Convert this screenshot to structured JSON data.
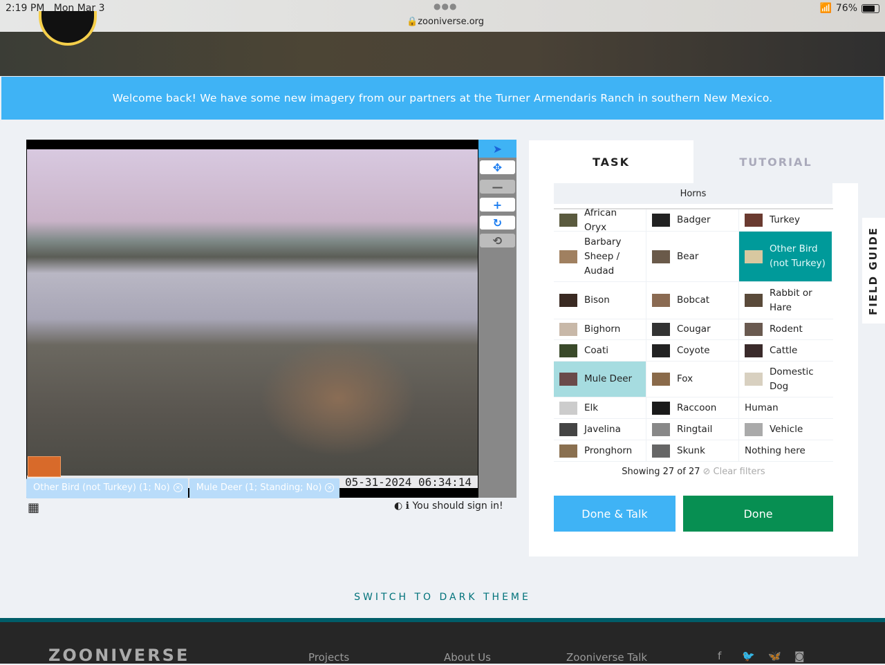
{
  "status_bar": {
    "time": "2:19 PM",
    "date": "Mon Mar 3",
    "url": "zooniverse.org",
    "battery": "76%"
  },
  "banner": "Welcome back! We have some new imagery from our partners at the Turner Armendaris Ranch in southern New Mexico.",
  "viewer": {
    "timestamp": "05-31-2024  06:34:14",
    "tools": [
      "pointer-icon",
      "move-icon",
      "zoom-out-icon",
      "zoom-in-icon",
      "rotate-icon",
      "reset-icon"
    ],
    "annotations": [
      {
        "label": "Other Bird (not Turkey) (1; No)"
      },
      {
        "label": "Mule Deer (1; Standing; No)"
      }
    ],
    "sign_in": "You should sign in!"
  },
  "tabs": [
    {
      "label": "TASK",
      "active": true
    },
    {
      "label": "TUTORIAL",
      "active": false
    }
  ],
  "filter": "Horns",
  "choices": [
    [
      "African Oryx",
      "Badger",
      "Turkey"
    ],
    [
      "Barbary Sheep / Audad",
      "Bear",
      "Other Bird (not Turkey)"
    ],
    [
      "Bison",
      "Bobcat",
      "Rabbit or Hare"
    ],
    [
      "Bighorn",
      "Cougar",
      "Rodent"
    ],
    [
      "Coati",
      "Coyote",
      "Cattle"
    ],
    [
      "Mule Deer",
      "Fox",
      "Domestic Dog"
    ],
    [
      "Elk",
      "Raccoon",
      "Human"
    ],
    [
      "Javelina",
      "Ringtail",
      "Vehicle"
    ],
    [
      "Pronghorn",
      "Skunk",
      "Nothing here"
    ]
  ],
  "selected": [
    "Other Bird (not Turkey)",
    "Mule Deer"
  ],
  "showing": "Showing 27 of 27",
  "clear_filters": "Clear filters",
  "buttons": {
    "done_talk": "Done & Talk",
    "done": "Done"
  },
  "field_guide": "FIELD GUIDE",
  "dark_theme": "SWITCH TO DARK THEME",
  "footer": {
    "logo": "ZOONIVERSE",
    "links": [
      "Projects",
      "About Us",
      "Zooniverse Talk"
    ],
    "social": [
      "facebook-icon",
      "twitter-icon",
      "bluesky-icon",
      "instagram-icon"
    ]
  },
  "colors": {
    "banner": "#3fb3f5",
    "selected": "#009a9a",
    "done": "#078f52",
    "done_talk": "#3fb3f5",
    "footer": "#262626"
  }
}
